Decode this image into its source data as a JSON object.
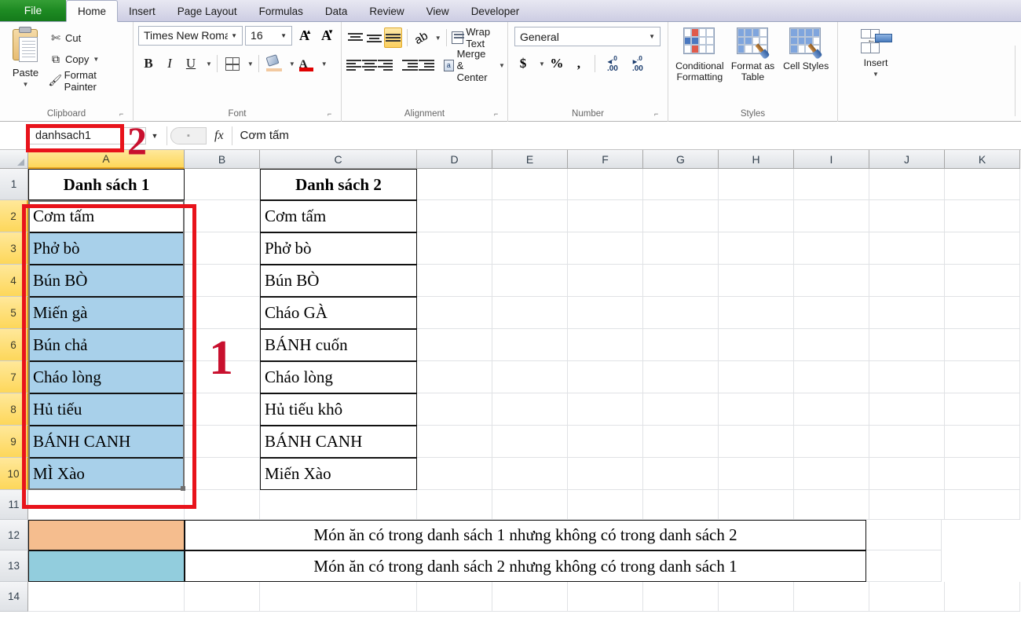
{
  "ribbon": {
    "tabs": [
      {
        "label": "File",
        "active": false,
        "file": true
      },
      {
        "label": "Home",
        "active": true
      },
      {
        "label": "Insert",
        "active": false
      },
      {
        "label": "Page Layout",
        "active": false
      },
      {
        "label": "Formulas",
        "active": false
      },
      {
        "label": "Data",
        "active": false
      },
      {
        "label": "Review",
        "active": false
      },
      {
        "label": "View",
        "active": false
      },
      {
        "label": "Developer",
        "active": false
      }
    ],
    "clipboard": {
      "group_label": "Clipboard",
      "paste_label": "Paste",
      "cut_label": "Cut",
      "copy_label": "Copy",
      "format_painter_label": "Format Painter"
    },
    "font": {
      "group_label": "Font",
      "font_name": "Times New Roma",
      "font_size": "16",
      "bold": "B",
      "italic": "I",
      "underline": "U",
      "grow_font": "A",
      "shrink_font": "A",
      "font_color_letter": "A"
    },
    "alignment": {
      "group_label": "Alignment",
      "wrap_text": "Wrap Text",
      "merge_center": "Merge & Center",
      "merge_icon_text": "a"
    },
    "number": {
      "group_label": "Number",
      "format": "General",
      "currency": "$",
      "percent": "%",
      "comma": ",",
      "increase_decimal": ".00",
      "decrease_decimal": ".00"
    },
    "styles": {
      "group_label": "Styles",
      "conditional_formatting": "Conditional Formatting",
      "format_as_table": "Format as Table",
      "cell_styles": "Cell Styles"
    },
    "cells": {
      "insert": "Insert"
    }
  },
  "formula_bar": {
    "name_box": "danhsach1",
    "formula_value": "Cơm tấm",
    "fx_label": "fx"
  },
  "grid": {
    "columns": [
      "A",
      "B",
      "C",
      "D",
      "E",
      "F",
      "G",
      "H",
      "I",
      "J",
      "K"
    ],
    "selected_column": "A",
    "rows": [
      "1",
      "2",
      "3",
      "4",
      "5",
      "6",
      "7",
      "8",
      "9",
      "10",
      "11",
      "12",
      "13",
      "14"
    ],
    "selected_rows": [
      "2",
      "3",
      "4",
      "5",
      "6",
      "7",
      "8",
      "9",
      "10"
    ],
    "headers": {
      "list1": "Danh sách 1",
      "list2": "Danh sách 2"
    },
    "list1": [
      "Cơm tấm",
      "Phở bò",
      "Bún BÒ",
      "Miến gà",
      "Bún chả",
      "Cháo lòng",
      "Hủ tiếu",
      "BÁNH CANH",
      "MÌ Xào"
    ],
    "list2": [
      "Cơm tấm",
      "Phở bò",
      "Bún BÒ",
      "Cháo GÀ",
      "BÁNH cuốn",
      "Cháo lòng",
      "Hủ tiếu khô",
      "BÁNH CANH",
      "Miến Xào"
    ],
    "legend": [
      {
        "color": "#f5bd8e",
        "text": "Món ăn có trong danh sách 1 nhưng không có trong danh sách 2"
      },
      {
        "color": "#92cddd",
        "text": "Món ăn có trong danh sách 2 nhưng không có trong danh sách 1"
      }
    ]
  },
  "annotations": {
    "marker_1": "1",
    "marker_2": "2",
    "highlight_color": "#e8131b"
  }
}
